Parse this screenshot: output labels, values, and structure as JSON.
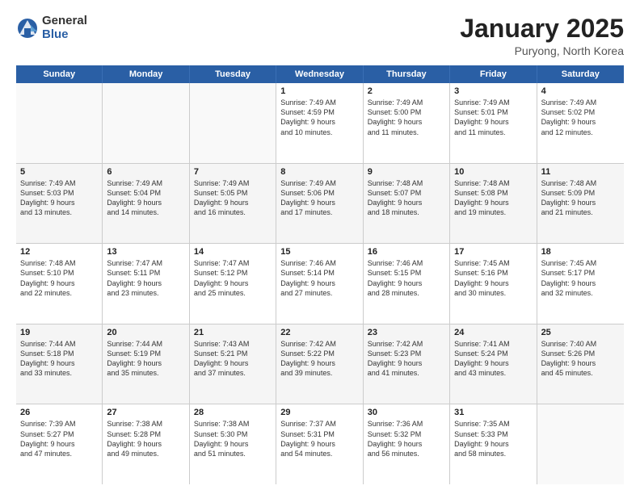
{
  "logo": {
    "general": "General",
    "blue": "Blue"
  },
  "header": {
    "title": "January 2025",
    "subtitle": "Puryong, North Korea"
  },
  "days": [
    "Sunday",
    "Monday",
    "Tuesday",
    "Wednesday",
    "Thursday",
    "Friday",
    "Saturday"
  ],
  "weeks": [
    [
      {
        "day": "",
        "empty": true
      },
      {
        "day": "",
        "empty": true
      },
      {
        "day": "",
        "empty": true
      },
      {
        "day": "1",
        "lines": [
          "Sunrise: 7:49 AM",
          "Sunset: 4:59 PM",
          "Daylight: 9 hours",
          "and 10 minutes."
        ]
      },
      {
        "day": "2",
        "lines": [
          "Sunrise: 7:49 AM",
          "Sunset: 5:00 PM",
          "Daylight: 9 hours",
          "and 11 minutes."
        ]
      },
      {
        "day": "3",
        "lines": [
          "Sunrise: 7:49 AM",
          "Sunset: 5:01 PM",
          "Daylight: 9 hours",
          "and 11 minutes."
        ]
      },
      {
        "day": "4",
        "lines": [
          "Sunrise: 7:49 AM",
          "Sunset: 5:02 PM",
          "Daylight: 9 hours",
          "and 12 minutes."
        ]
      }
    ],
    [
      {
        "day": "5",
        "lines": [
          "Sunrise: 7:49 AM",
          "Sunset: 5:03 PM",
          "Daylight: 9 hours",
          "and 13 minutes."
        ]
      },
      {
        "day": "6",
        "lines": [
          "Sunrise: 7:49 AM",
          "Sunset: 5:04 PM",
          "Daylight: 9 hours",
          "and 14 minutes."
        ]
      },
      {
        "day": "7",
        "lines": [
          "Sunrise: 7:49 AM",
          "Sunset: 5:05 PM",
          "Daylight: 9 hours",
          "and 16 minutes."
        ]
      },
      {
        "day": "8",
        "lines": [
          "Sunrise: 7:49 AM",
          "Sunset: 5:06 PM",
          "Daylight: 9 hours",
          "and 17 minutes."
        ]
      },
      {
        "day": "9",
        "lines": [
          "Sunrise: 7:48 AM",
          "Sunset: 5:07 PM",
          "Daylight: 9 hours",
          "and 18 minutes."
        ]
      },
      {
        "day": "10",
        "lines": [
          "Sunrise: 7:48 AM",
          "Sunset: 5:08 PM",
          "Daylight: 9 hours",
          "and 19 minutes."
        ]
      },
      {
        "day": "11",
        "lines": [
          "Sunrise: 7:48 AM",
          "Sunset: 5:09 PM",
          "Daylight: 9 hours",
          "and 21 minutes."
        ]
      }
    ],
    [
      {
        "day": "12",
        "lines": [
          "Sunrise: 7:48 AM",
          "Sunset: 5:10 PM",
          "Daylight: 9 hours",
          "and 22 minutes."
        ]
      },
      {
        "day": "13",
        "lines": [
          "Sunrise: 7:47 AM",
          "Sunset: 5:11 PM",
          "Daylight: 9 hours",
          "and 23 minutes."
        ]
      },
      {
        "day": "14",
        "lines": [
          "Sunrise: 7:47 AM",
          "Sunset: 5:12 PM",
          "Daylight: 9 hours",
          "and 25 minutes."
        ]
      },
      {
        "day": "15",
        "lines": [
          "Sunrise: 7:46 AM",
          "Sunset: 5:14 PM",
          "Daylight: 9 hours",
          "and 27 minutes."
        ]
      },
      {
        "day": "16",
        "lines": [
          "Sunrise: 7:46 AM",
          "Sunset: 5:15 PM",
          "Daylight: 9 hours",
          "and 28 minutes."
        ]
      },
      {
        "day": "17",
        "lines": [
          "Sunrise: 7:45 AM",
          "Sunset: 5:16 PM",
          "Daylight: 9 hours",
          "and 30 minutes."
        ]
      },
      {
        "day": "18",
        "lines": [
          "Sunrise: 7:45 AM",
          "Sunset: 5:17 PM",
          "Daylight: 9 hours",
          "and 32 minutes."
        ]
      }
    ],
    [
      {
        "day": "19",
        "lines": [
          "Sunrise: 7:44 AM",
          "Sunset: 5:18 PM",
          "Daylight: 9 hours",
          "and 33 minutes."
        ]
      },
      {
        "day": "20",
        "lines": [
          "Sunrise: 7:44 AM",
          "Sunset: 5:19 PM",
          "Daylight: 9 hours",
          "and 35 minutes."
        ]
      },
      {
        "day": "21",
        "lines": [
          "Sunrise: 7:43 AM",
          "Sunset: 5:21 PM",
          "Daylight: 9 hours",
          "and 37 minutes."
        ]
      },
      {
        "day": "22",
        "lines": [
          "Sunrise: 7:42 AM",
          "Sunset: 5:22 PM",
          "Daylight: 9 hours",
          "and 39 minutes."
        ]
      },
      {
        "day": "23",
        "lines": [
          "Sunrise: 7:42 AM",
          "Sunset: 5:23 PM",
          "Daylight: 9 hours",
          "and 41 minutes."
        ]
      },
      {
        "day": "24",
        "lines": [
          "Sunrise: 7:41 AM",
          "Sunset: 5:24 PM",
          "Daylight: 9 hours",
          "and 43 minutes."
        ]
      },
      {
        "day": "25",
        "lines": [
          "Sunrise: 7:40 AM",
          "Sunset: 5:26 PM",
          "Daylight: 9 hours",
          "and 45 minutes."
        ]
      }
    ],
    [
      {
        "day": "26",
        "lines": [
          "Sunrise: 7:39 AM",
          "Sunset: 5:27 PM",
          "Daylight: 9 hours",
          "and 47 minutes."
        ]
      },
      {
        "day": "27",
        "lines": [
          "Sunrise: 7:38 AM",
          "Sunset: 5:28 PM",
          "Daylight: 9 hours",
          "and 49 minutes."
        ]
      },
      {
        "day": "28",
        "lines": [
          "Sunrise: 7:38 AM",
          "Sunset: 5:30 PM",
          "Daylight: 9 hours",
          "and 51 minutes."
        ]
      },
      {
        "day": "29",
        "lines": [
          "Sunrise: 7:37 AM",
          "Sunset: 5:31 PM",
          "Daylight: 9 hours",
          "and 54 minutes."
        ]
      },
      {
        "day": "30",
        "lines": [
          "Sunrise: 7:36 AM",
          "Sunset: 5:32 PM",
          "Daylight: 9 hours",
          "and 56 minutes."
        ]
      },
      {
        "day": "31",
        "lines": [
          "Sunrise: 7:35 AM",
          "Sunset: 5:33 PM",
          "Daylight: 9 hours",
          "and 58 minutes."
        ]
      },
      {
        "day": "",
        "empty": true
      }
    ]
  ]
}
